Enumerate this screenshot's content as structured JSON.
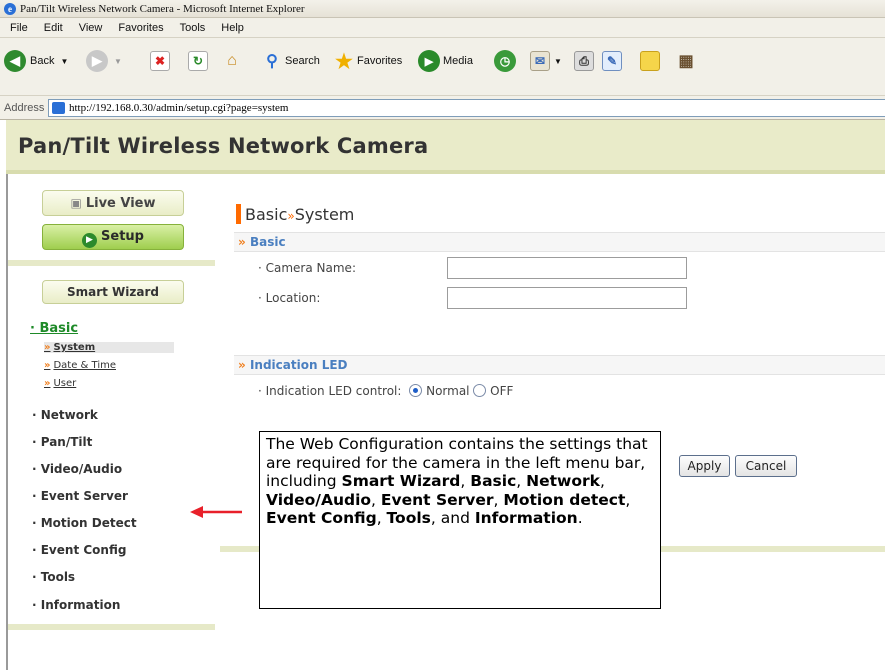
{
  "window": {
    "title": "Pan/Tilt Wireless Network Camera - Microsoft Internet Explorer"
  },
  "menubar": [
    "File",
    "Edit",
    "View",
    "Favorites",
    "Tools",
    "Help"
  ],
  "toolbar": {
    "back": "Back",
    "search": "Search",
    "favorites": "Favorites",
    "media": "Media"
  },
  "address": {
    "label": "Address",
    "url": "http://192.168.0.30/admin/setup.cgi?page=system"
  },
  "page": {
    "title": "Pan/Tilt Wireless Network Camera"
  },
  "sidebar": {
    "live_view": "Live View",
    "setup": "Setup",
    "smart_wizard": "Smart Wizard",
    "basic": "· Basic",
    "basic_subs": [
      "System",
      "Date & Time",
      "User"
    ],
    "items": [
      "· Network",
      "· Pan/Tilt",
      "· Video/Audio",
      "· Event Server",
      "· Motion Detect",
      "· Event Config",
      "· Tools",
      "· Information"
    ]
  },
  "main": {
    "title_part1": "Basic",
    "title_sep": "»",
    "title_part2": "System",
    "section_basic": "Basic",
    "camera_name_label": "· Camera Name:",
    "camera_name_value": "",
    "location_label": "· Location:",
    "location_value": "",
    "section_led": "Indication LED",
    "led_label": "· Indication LED control:",
    "led_normal": "Normal",
    "led_off": "OFF",
    "led_selected": "Normal",
    "apply": "Apply",
    "cancel": "Cancel"
  },
  "callout": {
    "t1": "The Web Configuration contains the settings that are required for the camera in the left menu bar, including ",
    "b1": "Smart Wizard",
    "t2": ", ",
    "b2": "Basic",
    "t3": ", ",
    "b3": "Network",
    "t4": ", ",
    "b4": "Video/Audio",
    "t5": ", ",
    "b5": "Event Server",
    "t6": ", ",
    "b6": "Motion detect",
    "t7": ", ",
    "b7": "Event Config",
    "t8": ", ",
    "b8": "Tools",
    "t9": ", and ",
    "b9": "Information",
    "t10": "."
  },
  "colors": {
    "header_bg": "#e9ebc9",
    "accent_orange": "#ff6a00",
    "setup_green": "#9fce4e",
    "section_text": "#4a7fc0",
    "arrow_red": "#e8202a"
  }
}
